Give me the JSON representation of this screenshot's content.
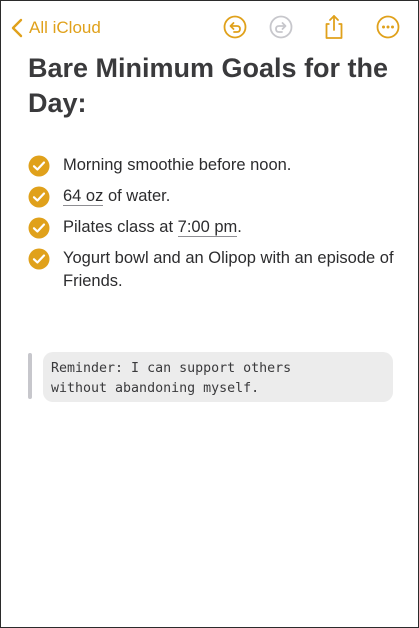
{
  "nav": {
    "back_label": "All iCloud",
    "accent_color": "#e0a11b",
    "icons": [
      "undo-icon",
      "redo-icon",
      "share-icon",
      "more-icon"
    ]
  },
  "note": {
    "title": "Bare Minimum Goals for the Day:",
    "checklist": [
      {
        "checked": true,
        "text": "Morning smoothie before noon."
      },
      {
        "checked": true,
        "text_prefix": "",
        "linked": "64 oz",
        "text_suffix": " of water."
      },
      {
        "checked": true,
        "text_prefix": "Pilates class at ",
        "linked": "7:00 pm",
        "text_suffix": "."
      },
      {
        "checked": true,
        "text": "Yogurt bowl and an Olipop with an episode of Friends."
      }
    ],
    "code_block": {
      "line1": "Reminder: I can support others",
      "line2": "without abandoning myself."
    }
  }
}
